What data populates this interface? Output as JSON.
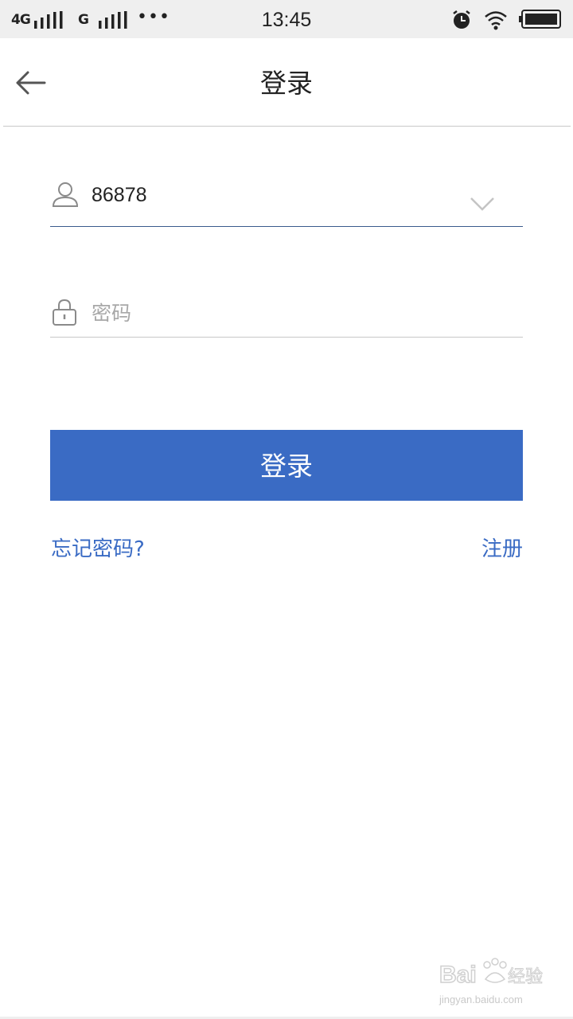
{
  "status_bar": {
    "network_1": "4G",
    "network_2": "G",
    "more": "•••",
    "time": "13:45",
    "icons": [
      "signal-icon",
      "signal-icon",
      "alarm-icon",
      "wifi-icon",
      "battery-icon"
    ]
  },
  "header": {
    "title": "登录",
    "back_icon": "arrow-left-icon"
  },
  "form": {
    "username_value": "86878",
    "username_icon": "user-icon",
    "dropdown_icon": "chevron-down-icon",
    "password_placeholder": "密码",
    "password_icon": "lock-icon"
  },
  "actions": {
    "login_label": "登录",
    "forgot_label": "忘记密码?",
    "register_label": "注册"
  },
  "colors": {
    "accent": "#3a6bc4",
    "status_bar_bg": "#efefef",
    "divider": "#c9c9c9"
  },
  "watermark": {
    "logo_text": "Bai 经验",
    "url": "jingyan.baidu.com"
  }
}
